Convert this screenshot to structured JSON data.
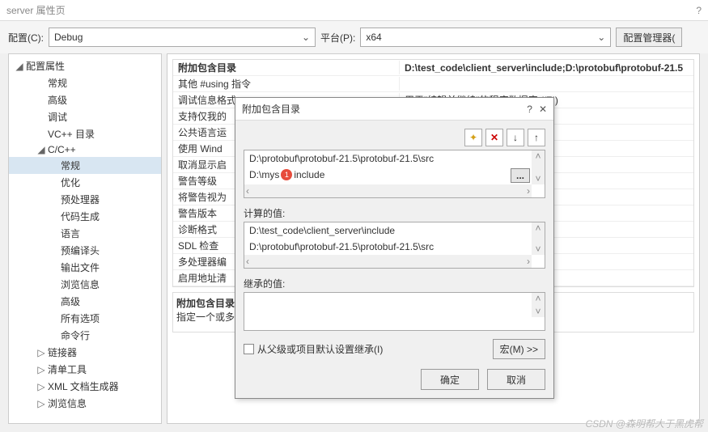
{
  "window": {
    "title": "server 属性页",
    "help": "?"
  },
  "top": {
    "config_label": "配置(C):",
    "config_value": "Debug",
    "platform_label": "平台(P):",
    "platform_value": "x64",
    "manager_btn": "配置管理器(",
    "arrow": "⌄"
  },
  "tree": {
    "root": "配置属性",
    "items": [
      {
        "label": "常规",
        "indent": 1
      },
      {
        "label": "高级",
        "indent": 1
      },
      {
        "label": "调试",
        "indent": 1
      },
      {
        "label": "VC++ 目录",
        "indent": 1
      },
      {
        "label": "C/C++",
        "indent": 1,
        "expandable": true,
        "expanded": true
      },
      {
        "label": "常规",
        "indent": 2,
        "selected": true
      },
      {
        "label": "优化",
        "indent": 2
      },
      {
        "label": "预处理器",
        "indent": 2
      },
      {
        "label": "代码生成",
        "indent": 2
      },
      {
        "label": "语言",
        "indent": 2
      },
      {
        "label": "预编译头",
        "indent": 2
      },
      {
        "label": "输出文件",
        "indent": 2
      },
      {
        "label": "浏览信息",
        "indent": 2
      },
      {
        "label": "高级",
        "indent": 2
      },
      {
        "label": "所有选项",
        "indent": 2
      },
      {
        "label": "命令行",
        "indent": 2
      },
      {
        "label": "链接器",
        "indent": 1,
        "expandable": true
      },
      {
        "label": "清单工具",
        "indent": 1,
        "expandable": true
      },
      {
        "label": "XML 文档生成器",
        "indent": 1,
        "expandable": true
      },
      {
        "label": "浏览信息",
        "indent": 1,
        "expandable": true
      }
    ]
  },
  "grid": {
    "rows": [
      {
        "key": "附加包含目录",
        "val": "D:\\test_code\\client_server\\include;D:\\protobuf\\protobuf-21.5",
        "bold": true
      },
      {
        "key": "其他 #using 指令",
        "val": ""
      },
      {
        "key": "调试信息格式",
        "val": "用于\"编辑并继续\"的程序数据库  (/ZI)"
      },
      {
        "key": "支持仅我的",
        "val": ""
      },
      {
        "key": "公共语言运",
        "val": ""
      },
      {
        "key": "使用 Wind",
        "val": ""
      },
      {
        "key": "取消显示启",
        "val": ""
      },
      {
        "key": "警告等级",
        "val": ""
      },
      {
        "key": "将警告视为",
        "val": ""
      },
      {
        "key": "警告版本",
        "val": ""
      },
      {
        "key": "诊断格式",
        "val": ""
      },
      {
        "key": "SDL 检查",
        "val": ""
      },
      {
        "key": "多处理器编",
        "val": ""
      },
      {
        "key": "启用地址清",
        "val": ""
      }
    ],
    "desc_title": "附加包含目录",
    "desc_body": "指定一个或多"
  },
  "modal": {
    "title": "附加包含目录",
    "entries": [
      "D:\\protobuf\\protobuf-21.5\\protobuf-21.5\\src",
      "D:\\mysqinclude"
    ],
    "badge": "1",
    "entry_parts": {
      "pre": "D:\\mys",
      "post": "include"
    },
    "toolbar": {
      "new": "✦",
      "delete": "✕",
      "down": "↓",
      "up": "↑"
    },
    "ellipsis": "...",
    "computed_label": "计算的值:",
    "computed": [
      "D:\\test_code\\client_server\\include",
      "D:\\protobuf\\protobuf-21.5\\protobuf-21.5\\src"
    ],
    "inherited_label": "继承的值:",
    "inherit_checkbox": "从父级或项目默认设置继承(I)",
    "macro_btn": "宏(M) >>",
    "ok": "确定",
    "cancel": "取消",
    "help": "?",
    "close": "✕",
    "scroll": {
      "up": "˄",
      "down": "˅",
      "left": "‹",
      "right": "›"
    }
  },
  "watermark": "CSDN @森明帮大于黑虎帮"
}
